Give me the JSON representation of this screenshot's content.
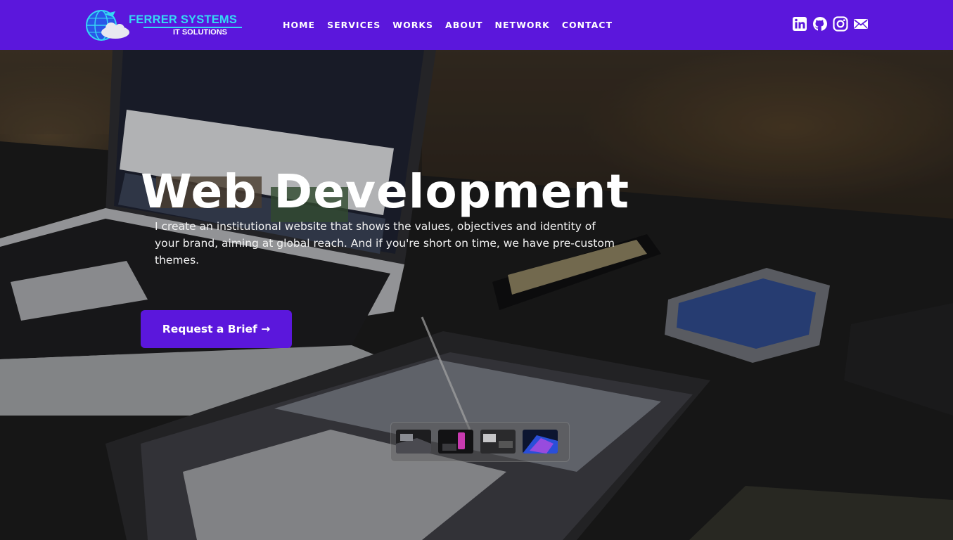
{
  "brand": {
    "name": "FERRER SYSTEMS",
    "tagline": "IT SOLUTIONS"
  },
  "nav": {
    "items": [
      "HOME",
      "SERVICES",
      "WORKS",
      "ABOUT",
      "NETWORK",
      "CONTACT"
    ]
  },
  "social": {
    "icons": [
      "linkedin-icon",
      "github-icon",
      "instagram-icon",
      "mail-icon"
    ]
  },
  "hero": {
    "title": "Web Development",
    "description": "I create an institutional website that shows the values, objectives and identity of your brand, aiming at global reach. And if you're short on time, we have pre-custom themes.",
    "cta_label": "Request a Brief →",
    "slides_count": 4
  },
  "colors": {
    "brand_purple": "#5b17dc",
    "logo_cyan": "#35d8f4"
  }
}
